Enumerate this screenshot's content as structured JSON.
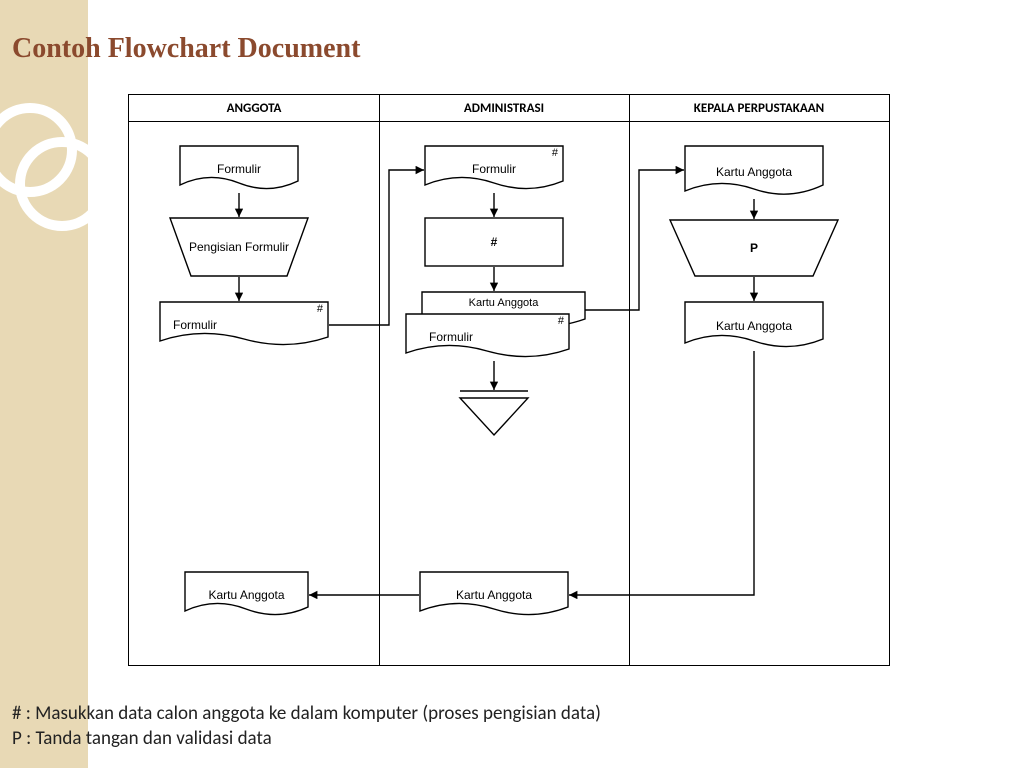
{
  "title": "Contoh Flowchart Document",
  "columns": {
    "c1": "ANGGOTA",
    "c2": "ADMINISTRASI",
    "c3": "KEPALA PERPUSTAKAAN"
  },
  "nodes": {
    "anggota_formulir1": "Formulir",
    "anggota_pengisian": "Pengisian Formulir",
    "anggota_formulir2": "Formulir",
    "anggota_kartu": "Kartu Anggota",
    "admin_formulir1": "Formulir",
    "admin_hash": "#",
    "admin_kartu_stack_back": "Kartu Anggota",
    "admin_kartu_stack_front": "Formulir",
    "admin_kartu_bottom": "Kartu Anggota",
    "kepala_kartu1": "Kartu Anggota",
    "kepala_p": "P",
    "kepala_kartu2": "Kartu Anggota"
  },
  "tags": {
    "hash": "#"
  },
  "legend": {
    "l1": "# : Masukkan data calon anggota ke dalam komputer (proses pengisian data)",
    "l2": "P : Tanda tangan dan validasi data"
  }
}
